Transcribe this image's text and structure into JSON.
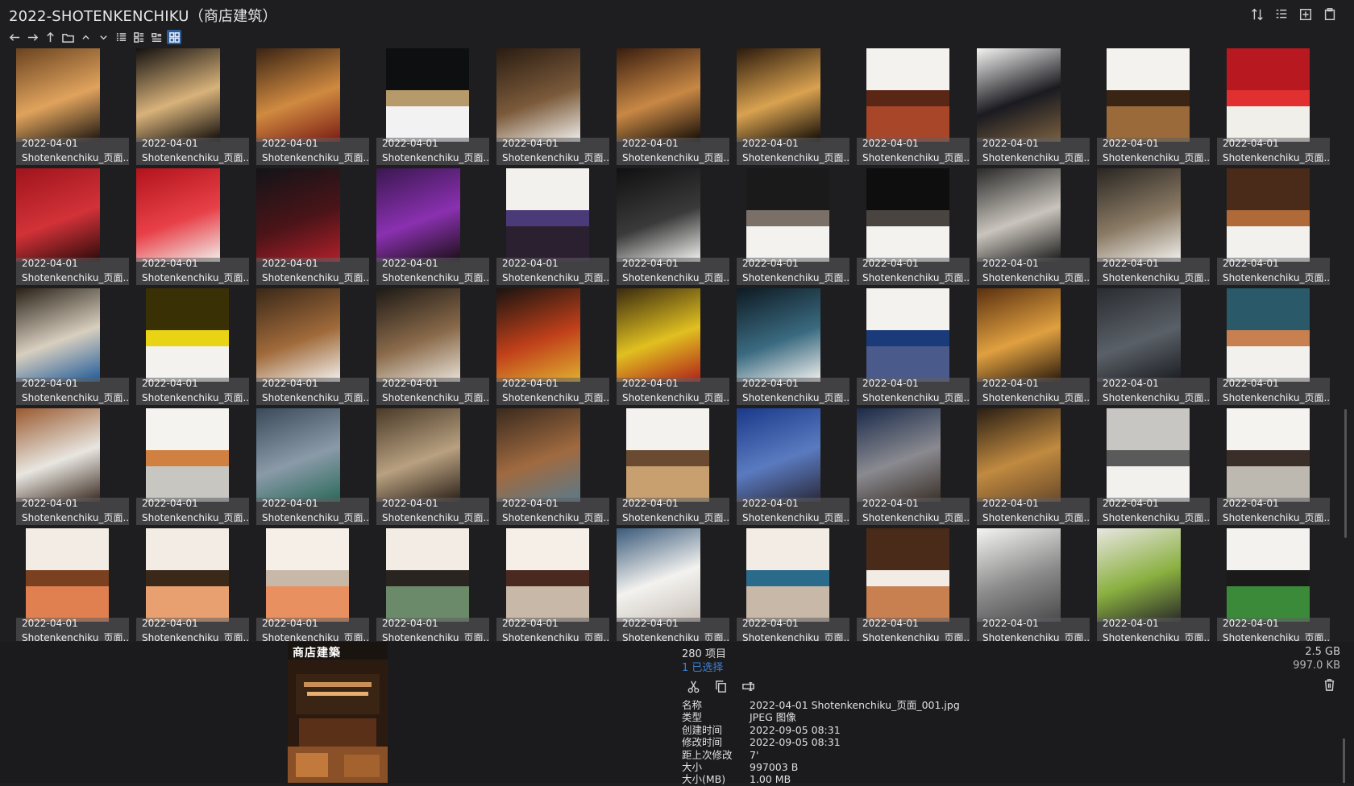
{
  "window": {
    "title": "2022-SHOTENKENCHIKU（商店建筑）"
  },
  "toolbar_icons": [
    "sort-icon",
    "list-details-icon",
    "new-window-icon",
    "clipboard-icon"
  ],
  "nav_icons": [
    "back-icon",
    "forward-icon",
    "up-icon",
    "folder-icon",
    "chevron-up-icon",
    "chevron-down-icon",
    "view-list-icon",
    "view-details-icon",
    "view-tiles-icon",
    "view-grid-icon"
  ],
  "grid": {
    "rows": [
      {
        "items": [
          {
            "date": "2022-04-01",
            "name": "Shotenkenchiku_页面...",
            "orient": "land",
            "colors": [
              "#6a4320",
              "#e0a35d",
              "#1a1410"
            ]
          },
          {
            "date": "2022-04-01",
            "name": "Shotenkenchiku_页面...",
            "orient": "land",
            "colors": [
              "#151210",
              "#d8b27a",
              "#0c0a09"
            ]
          },
          {
            "date": "2022-04-01",
            "name": "Shotenkenchiku_页面...",
            "orient": "land",
            "colors": [
              "#3b2414",
              "#d08a40",
              "#7a1c14"
            ]
          },
          {
            "date": "2022-04-01",
            "name": "Shotenkenchiku_页面...",
            "orient": "port",
            "colors": [
              "#0e0f10",
              "#b79a6a",
              "#f2f2f2"
            ]
          },
          {
            "date": "2022-04-01",
            "name": "Shotenkenchiku_页面...",
            "orient": "land",
            "colors": [
              "#2a1c12",
              "#7b5a3a",
              "#f0efeb"
            ]
          },
          {
            "date": "2022-04-01",
            "name": "Shotenkenchiku_页面...",
            "orient": "land",
            "colors": [
              "#3a1d0e",
              "#c88845",
              "#120b07"
            ]
          },
          {
            "date": "2022-04-01",
            "name": "Shotenkenchiku_页面...",
            "orient": "land",
            "colors": [
              "#2c1a0c",
              "#d9a250",
              "#0e0a06"
            ]
          },
          {
            "date": "2022-04-01",
            "name": "Shotenkenchiku_页面...",
            "orient": "port",
            "colors": [
              "#f3f2ef",
              "#5a2616",
              "#a8462a"
            ]
          },
          {
            "date": "2022-04-01",
            "name": "Shotenkenchiku_页面...",
            "orient": "land",
            "colors": [
              "#f4f4f2",
              "#1a1a20",
              "#7a6040"
            ]
          },
          {
            "date": "2022-04-01",
            "name": "Shotenkenchiku_页面...",
            "orient": "port",
            "colors": [
              "#f3f2ef",
              "#3a2414",
              "#9a6a3a"
            ]
          },
          {
            "date": "2022-04-01",
            "name": "Shotenkenchiku_页面...",
            "orient": "port",
            "colors": [
              "#b81820",
              "#e03030",
              "#f1efe9"
            ]
          }
        ]
      },
      {
        "items": [
          {
            "date": "2022-04-01",
            "name": "Shotenkenchiku_页面...",
            "orient": "land",
            "colors": [
              "#a0141c",
              "#d23238",
              "#2a0a0a"
            ]
          },
          {
            "date": "2022-04-01",
            "name": "Shotenkenchiku_页面...",
            "orient": "land",
            "colors": [
              "#b2141c",
              "#e84048",
              "#f2f0ec"
            ]
          },
          {
            "date": "2022-04-01",
            "name": "Shotenkenchiku_页面...",
            "orient": "land",
            "colors": [
              "#121418",
              "#4a1418",
              "#b0202a"
            ]
          },
          {
            "date": "2022-04-01",
            "name": "Shotenkenchiku_页面...",
            "orient": "land",
            "colors": [
              "#3a1850",
              "#8a30b0",
              "#1a1014"
            ]
          },
          {
            "date": "2022-04-01",
            "name": "Shotenkenchiku_页面...",
            "orient": "port",
            "colors": [
              "#f2f1ee",
              "#4a3a78",
              "#2a2030"
            ]
          },
          {
            "date": "2022-04-01",
            "name": "Shotenkenchiku_页面...",
            "orient": "land",
            "colors": [
              "#101010",
              "#3a3a3a",
              "#f4f4f2"
            ]
          },
          {
            "date": "2022-04-01",
            "name": "Shotenkenchiku_页面...",
            "orient": "port",
            "colors": [
              "#1a1a1a",
              "#7a7068",
              "#f3f2ef"
            ]
          },
          {
            "date": "2022-04-01",
            "name": "Shotenkenchiku_页面...",
            "orient": "port",
            "colors": [
              "#0e0e0e",
              "#4a4440",
              "#f3f2ef"
            ]
          },
          {
            "date": "2022-04-01",
            "name": "Shotenkenchiku_页面...",
            "orient": "land",
            "colors": [
              "#2a2a2a",
              "#c9c4bc",
              "#1a1a1a"
            ]
          },
          {
            "date": "2022-04-01",
            "name": "Shotenkenchiku_页面...",
            "orient": "land",
            "colors": [
              "#2a2622",
              "#8a7a64",
              "#f2f1ee"
            ]
          },
          {
            "date": "2022-04-01",
            "name": "Shotenkenchiku_页面...",
            "orient": "port",
            "colors": [
              "#4a2a18",
              "#b06a3a",
              "#f2f1ee"
            ]
          }
        ]
      },
      {
        "items": [
          {
            "date": "2022-04-01",
            "name": "Shotenkenchiku_页面...",
            "orient": "land",
            "colors": [
              "#2a2218",
              "#d8cfbf",
              "#1e5a9a"
            ]
          },
          {
            "date": "2022-04-01",
            "name": "Shotenkenchiku_页面...",
            "orient": "port",
            "colors": [
              "#3a3006",
              "#e8d414",
              "#f3f2ef"
            ]
          },
          {
            "date": "2022-04-01",
            "name": "Shotenkenchiku_页面...",
            "orient": "land",
            "colors": [
              "#3a2818",
              "#a06a3a",
              "#f3f2ef"
            ]
          },
          {
            "date": "2022-04-01",
            "name": "Shotenkenchiku_页面...",
            "orient": "land",
            "colors": [
              "#1e1a16",
              "#8a6a4a",
              "#e8e2d8"
            ]
          },
          {
            "date": "2022-04-01",
            "name": "Shotenkenchiku_页面...",
            "orient": "land",
            "colors": [
              "#1a1410",
              "#c0401a",
              "#e0b030"
            ]
          },
          {
            "date": "2022-04-01",
            "name": "Shotenkenchiku_页面...",
            "orient": "land",
            "colors": [
              "#3a2a10",
              "#e0c020",
              "#b0201a"
            ]
          },
          {
            "date": "2022-04-01",
            "name": "Shotenkenchiku_页面...",
            "orient": "land",
            "colors": [
              "#0e1a22",
              "#3a6a80",
              "#f2f1ee"
            ]
          },
          {
            "date": "2022-04-01",
            "name": "Shotenkenchiku_页面...",
            "orient": "port",
            "colors": [
              "#f3f2ef",
              "#1a3a7a",
              "#4a5a8a"
            ]
          },
          {
            "date": "2022-04-01",
            "name": "Shotenkenchiku_页面...",
            "orient": "land",
            "colors": [
              "#5a3010",
              "#e0a040",
              "#2a1a0e"
            ]
          },
          {
            "date": "2022-04-01",
            "name": "Shotenkenchiku_页面...",
            "orient": "land",
            "colors": [
              "#2a2c30",
              "#5a6068",
              "#1a1c20"
            ]
          },
          {
            "date": "2022-04-01",
            "name": "Shotenkenchiku_页面...",
            "orient": "port",
            "colors": [
              "#2a5a6a",
              "#c88050",
              "#f2f1ee"
            ]
          }
        ]
      },
      {
        "items": [
          {
            "date": "2022-04-01",
            "name": "Shotenkenchiku_页面...",
            "orient": "land",
            "colors": [
              "#9a5a30",
              "#e8e6e0",
              "#3a2a20"
            ]
          },
          {
            "date": "2022-04-01",
            "name": "Shotenkenchiku_页面...",
            "orient": "port",
            "colors": [
              "#f4f3f0",
              "#d08040",
              "#c8c6c0"
            ]
          },
          {
            "date": "2022-04-01",
            "name": "Shotenkenchiku_页面...",
            "orient": "land",
            "colors": [
              "#3a4a5a",
              "#8a9aa8",
              "#2a6a5a"
            ]
          },
          {
            "date": "2022-04-01",
            "name": "Shotenkenchiku_页面...",
            "orient": "land",
            "colors": [
              "#4a3a28",
              "#b8a080",
              "#2a2018"
            ]
          },
          {
            "date": "2022-04-01",
            "name": "Shotenkenchiku_页面...",
            "orient": "land",
            "colors": [
              "#3a2a1e",
              "#a06a40",
              "#5a7a8a"
            ]
          },
          {
            "date": "2022-04-01",
            "name": "Shotenkenchiku_页面...",
            "orient": "port",
            "colors": [
              "#f3f2ef",
              "#6a4a30",
              "#c8a070"
            ]
          },
          {
            "date": "2022-04-01",
            "name": "Shotenkenchiku_页面...",
            "orient": "land",
            "colors": [
              "#1a3a8a",
              "#5a7ac0",
              "#2a2a3a"
            ]
          },
          {
            "date": "2022-04-01",
            "name": "Shotenkenchiku_页面...",
            "orient": "land",
            "colors": [
              "#1a2a4a",
              "#8a8a90",
              "#3a3028"
            ]
          },
          {
            "date": "2022-04-01",
            "name": "Shotenkenchiku_页面...",
            "orient": "land",
            "colors": [
              "#2a1e14",
              "#c08a40",
              "#6a4a2a"
            ]
          },
          {
            "date": "2022-04-01",
            "name": "Shotenkenchiku_页面...",
            "orient": "port",
            "colors": [
              "#c8c6c2",
              "#5a5a5a",
              "#f2f1ee"
            ]
          },
          {
            "date": "2022-04-01",
            "name": "Shotenkenchiku_页面...",
            "orient": "port",
            "colors": [
              "#f4f3f0",
              "#3a2e28",
              "#bdb8b0"
            ]
          }
        ]
      },
      {
        "items": [
          {
            "date": "2022-04-01",
            "name": "Shotenkenchiku_页面...",
            "orient": "port",
            "colors": [
              "#f3ece4",
              "#7a4020",
              "#e08050"
            ]
          },
          {
            "date": "2022-04-01",
            "name": "Shotenkenchiku_页面...",
            "orient": "port",
            "colors": [
              "#f3ece4",
              "#3a2818",
              "#e8a070"
            ]
          },
          {
            "date": "2022-04-01",
            "name": "Shotenkenchiku_页面...",
            "orient": "port",
            "colors": [
              "#f6efe8",
              "#c8b8a8",
              "#e89060"
            ]
          },
          {
            "date": "2022-04-01",
            "name": "Shotenkenchiku_页面...",
            "orient": "port",
            "colors": [
              "#f3ece4",
              "#2a2420",
              "#6a8a6a"
            ]
          },
          {
            "date": "2022-04-01",
            "name": "Shotenkenchiku_页面...",
            "orient": "port",
            "colors": [
              "#f6efe8",
              "#4a2a20",
              "#c8b8a8"
            ]
          },
          {
            "date": "2022-04-01",
            "name": "Shotenkenchiku_页面...",
            "orient": "land",
            "colors": [
              "#3a5a7a",
              "#f3f2ef",
              "#c8c0b8"
            ]
          },
          {
            "date": "2022-04-01",
            "name": "Shotenkenchiku_页面...",
            "orient": "port",
            "colors": [
              "#f3ece4",
              "#2a6a8a",
              "#c8b8a8"
            ]
          },
          {
            "date": "2022-04-01",
            "name": "Shotenkenchiku_页面...",
            "orient": "port",
            "colors": [
              "#4a2a18",
              "#f3ece4",
              "#c88050"
            ]
          },
          {
            "date": "2022-04-01",
            "name": "Shotenkenchiku_页面...",
            "orient": "land",
            "colors": [
              "#f4f4f2",
              "#8a8a8a",
              "#4a4a4a"
            ]
          },
          {
            "date": "2022-04-01",
            "name": "Shotenkenchiku_页面...",
            "orient": "land",
            "colors": [
              "#e8e6e0",
              "#8ab040",
              "#2a2a2a"
            ]
          },
          {
            "date": "2022-04-01",
            "name": "Shotenkenchiku_页面...",
            "orient": "port",
            "colors": [
              "#f3f2ef",
              "#1a1a1a",
              "#3a8a3a"
            ]
          }
        ]
      }
    ]
  },
  "details": {
    "item_count": "280 项目",
    "selected": "1 已选择",
    "total_size": "2.5 GB",
    "selected_size": "997.0 KB",
    "preview_cover_title": "商店建築",
    "actions": [
      "cut-icon",
      "copy-icon",
      "rename-icon"
    ],
    "properties": [
      {
        "key": "名称",
        "value": "2022-04-01 Shotenkenchiku_页面_001.jpg"
      },
      {
        "key": "类型",
        "value": "JPEG 图像"
      },
      {
        "key": "创建时间",
        "value": "2022-09-05  08:31"
      },
      {
        "key": "修改时间",
        "value": "2022-09-05  08:31"
      },
      {
        "key": "距上次修改",
        "value": "7'"
      },
      {
        "key": "大小",
        "value": "997003 B"
      },
      {
        "key": "大小(MB)",
        "value": "1.00 MB"
      }
    ]
  }
}
